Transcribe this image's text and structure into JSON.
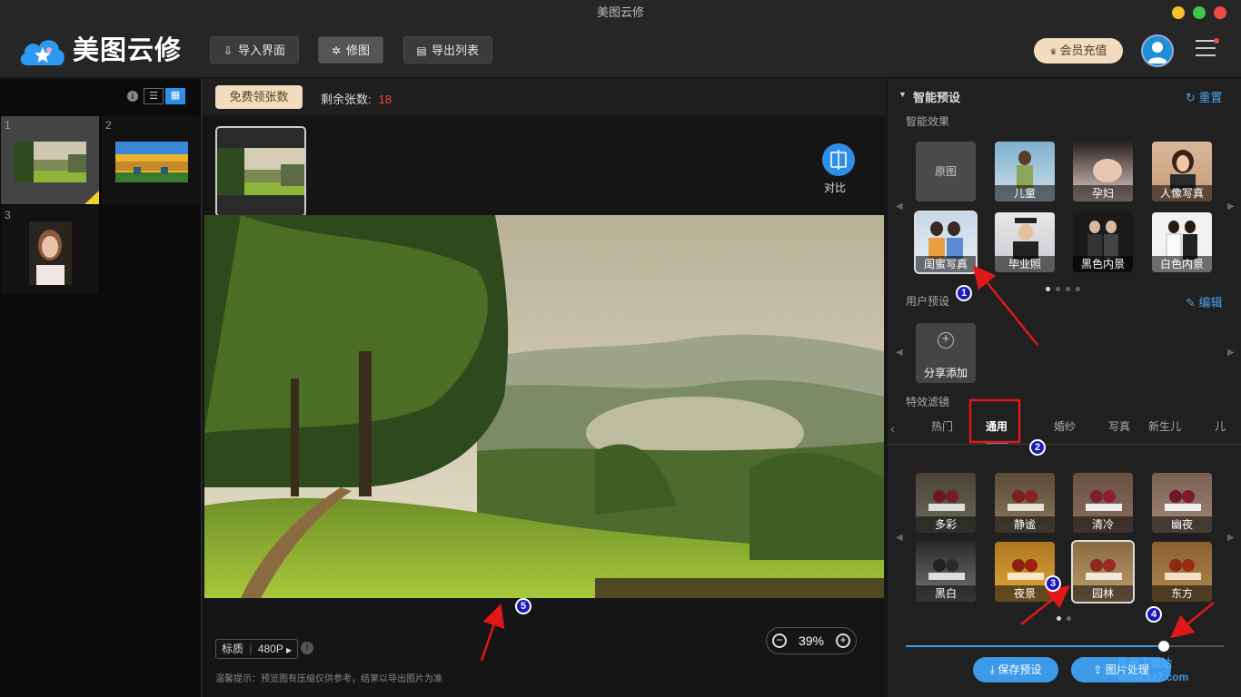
{
  "window": {
    "title": "美图云修"
  },
  "header": {
    "app_name": "美图云修",
    "import_label": "导入界面",
    "retouch_label": "修图",
    "export_label": "导出列表",
    "vip_label": "会员充值"
  },
  "left_panel": {
    "thumbnails": [
      {
        "num": "1"
      },
      {
        "num": "2"
      },
      {
        "num": "3"
      }
    ]
  },
  "center": {
    "free_label": "免费领张数",
    "remain_label": "剩余张数:",
    "remain_value": "18",
    "compare_label": "对比",
    "quality_label": "标质",
    "quality_value": "480P",
    "hint": "温馨提示：预览图有压缩仅供参考，结果以导出图片为准",
    "zoom_value": "39%"
  },
  "right_panel": {
    "smart_preset_title": "智能预设",
    "reset_label": "重置",
    "smart_effects_title": "智能效果",
    "smart_effects": [
      {
        "label": "原图"
      },
      {
        "label": "儿童"
      },
      {
        "label": "孕妇"
      },
      {
        "label": "人像写真"
      },
      {
        "label": "闺蜜写真"
      },
      {
        "label": "毕业照"
      },
      {
        "label": "黑色内景"
      },
      {
        "label": "白色内景"
      }
    ],
    "user_preset_title": "用户预设",
    "edit_label": "编辑",
    "share_add_label": "分享添加",
    "filter_title": "特效滤镜",
    "filter_tabs": [
      {
        "label": "热门"
      },
      {
        "label": "通用"
      },
      {
        "label": "婚纱"
      },
      {
        "label": "写真"
      },
      {
        "label": "新生儿"
      },
      {
        "label": "儿"
      }
    ],
    "filters": [
      {
        "label": "多彩"
      },
      {
        "label": "静谧"
      },
      {
        "label": "清冷"
      },
      {
        "label": "幽夜"
      },
      {
        "label": "黑白"
      },
      {
        "label": "夜景"
      },
      {
        "label": "园林"
      },
      {
        "label": "东方"
      }
    ],
    "slider_value": 0.81,
    "save_preset_label": "保存预设",
    "batch_label": "图片处理"
  },
  "annotations": [
    "1",
    "2",
    "3",
    "4",
    "5"
  ],
  "watermark": "极光下载站 www.xz7.com",
  "colors": {
    "accent": "#3d9ae8",
    "vip": "#f1dcc0",
    "remain": "#f04040",
    "annotation_red": "#e01818"
  }
}
